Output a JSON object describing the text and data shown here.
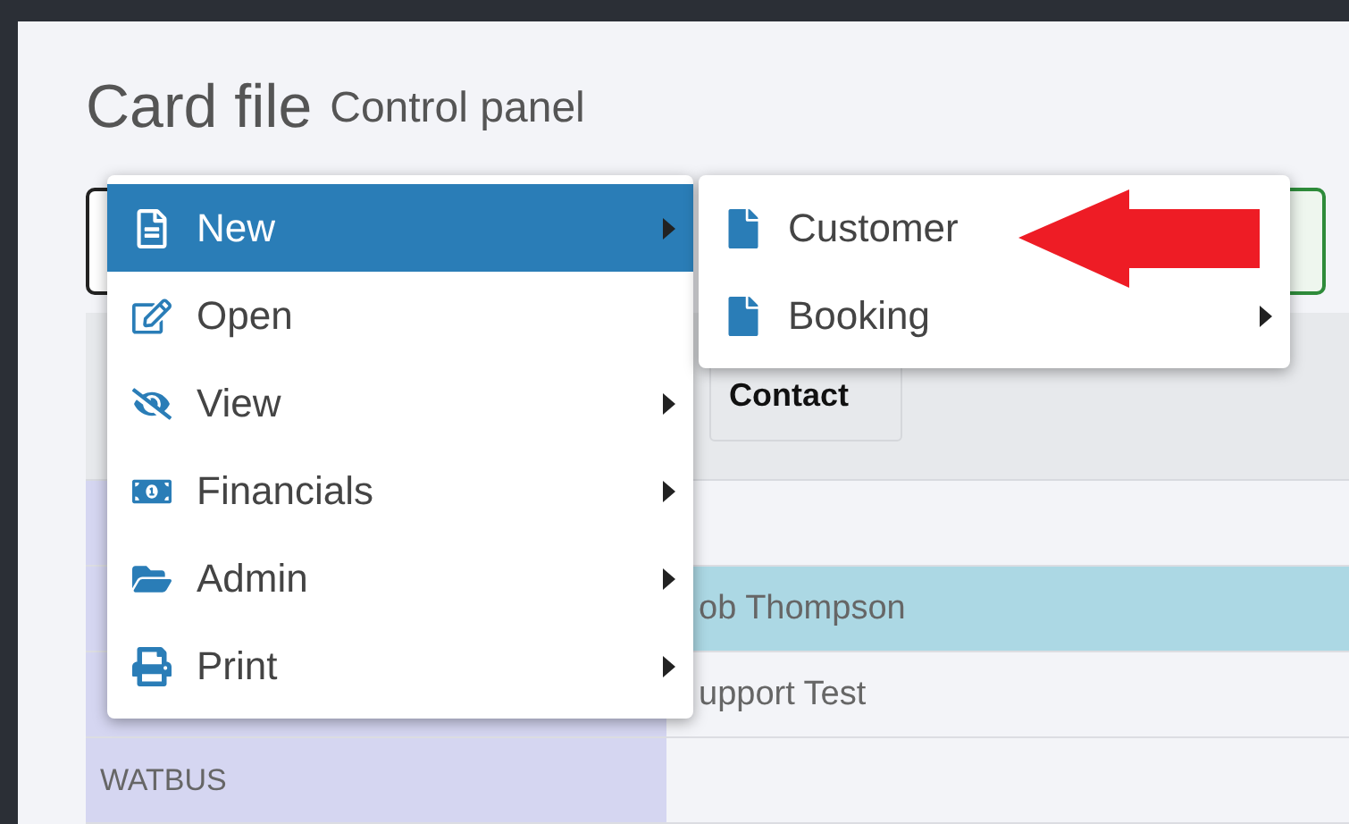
{
  "page": {
    "title": "Card file",
    "subtitle": "Control panel"
  },
  "table": {
    "columns": [
      {
        "label": "Contact"
      }
    ],
    "rows": [
      {
        "selected": false
      },
      {
        "contact": "ob Thompson",
        "selected": true
      },
      {
        "contact": "upport Test",
        "selected": false
      },
      {
        "code": "WATBUS",
        "selected": false
      }
    ]
  },
  "menu": {
    "items": [
      {
        "label": "New",
        "selected": true,
        "submenu": true
      },
      {
        "label": "Open",
        "selected": false,
        "submenu": false
      },
      {
        "label": "View",
        "selected": false,
        "submenu": true
      },
      {
        "label": "Financials",
        "selected": false,
        "submenu": true
      },
      {
        "label": "Admin",
        "selected": false,
        "submenu": true
      },
      {
        "label": "Print",
        "selected": false,
        "submenu": true
      }
    ]
  },
  "submenu": {
    "items": [
      {
        "label": "Customer",
        "selected": false,
        "submenu": false
      },
      {
        "label": "Booking",
        "selected": false,
        "submenu": true
      }
    ]
  }
}
